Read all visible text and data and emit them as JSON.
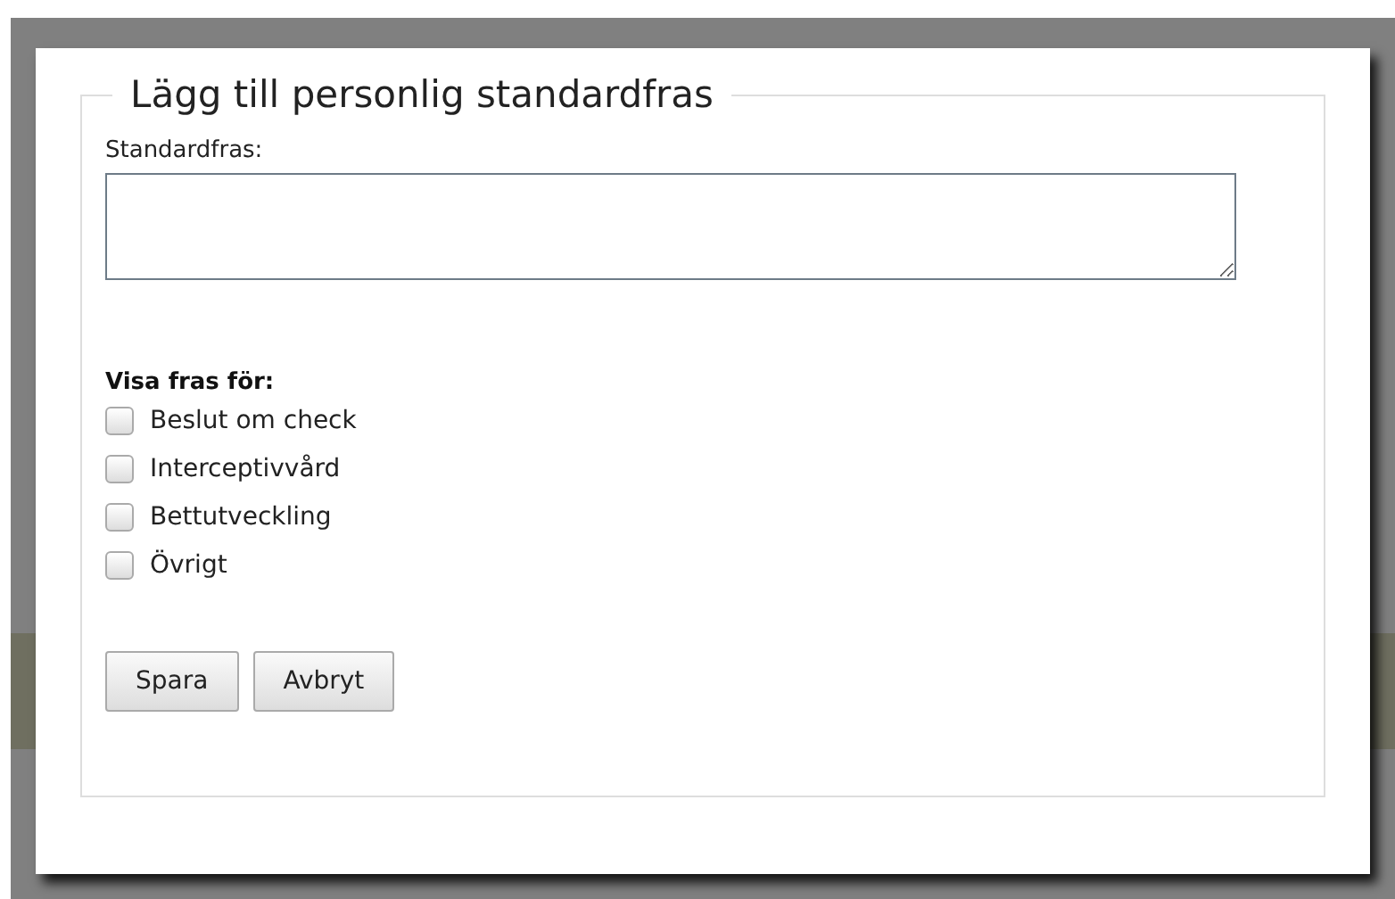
{
  "dialog": {
    "legend": "Lägg till personlig standardfras",
    "field_label": "Standardfras:",
    "group_label": "Visa fras för:",
    "options": [
      {
        "label": "Beslut om check",
        "checked": false
      },
      {
        "label": "Interceptivvård",
        "checked": false
      },
      {
        "label": "Bettutveckling",
        "checked": false
      },
      {
        "label": "Övrigt",
        "checked": false
      }
    ],
    "buttons": [
      "Spara",
      "Avbryt"
    ]
  }
}
